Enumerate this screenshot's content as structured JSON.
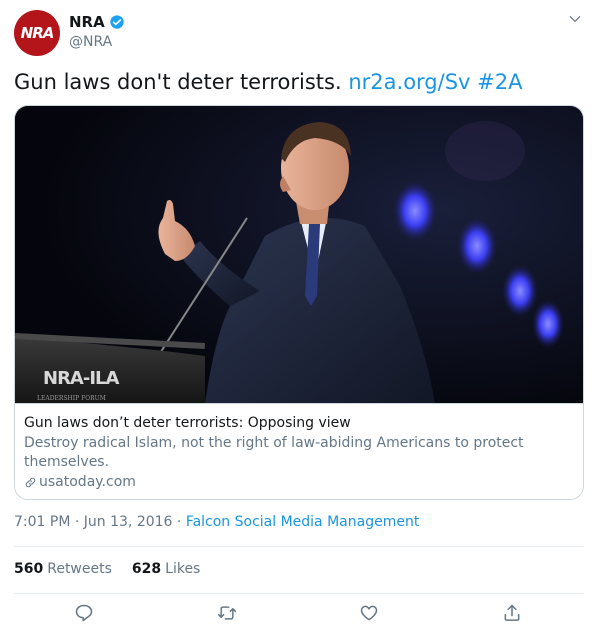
{
  "account": {
    "avatar_text": "NRA",
    "display_name": "NRA",
    "handle": "@NRA",
    "verified": true
  },
  "tweet": {
    "text": "Gun laws don't deter terrorists.",
    "link": "nr2a.org/Sv",
    "hashtag": "#2A"
  },
  "card": {
    "image_lectern_text": "NRA-ILA",
    "image_lectern_subtext": "LEADERSHIP FORUM",
    "title": "Gun laws don’t deter terrorists: Opposing view",
    "description": "Destroy radical Islam, not the right of law-abiding Americans to protect themselves.",
    "domain": "usatoday.com"
  },
  "meta": {
    "time": "7:01 PM",
    "date": "Jun 13, 2016",
    "source": "Falcon Social Media Management"
  },
  "stats": {
    "retweets_count": "560",
    "retweets_label": "Retweets",
    "likes_count": "628",
    "likes_label": "Likes"
  },
  "colors": {
    "link": "#1b95e0",
    "secondary_text": "#657786",
    "avatar_bg": "#b3151b",
    "verified": "#1da1f2"
  },
  "icons": [
    "chevron-down-icon",
    "verified-icon",
    "link-icon",
    "reply-icon",
    "retweet-icon",
    "like-icon",
    "share-icon"
  ]
}
